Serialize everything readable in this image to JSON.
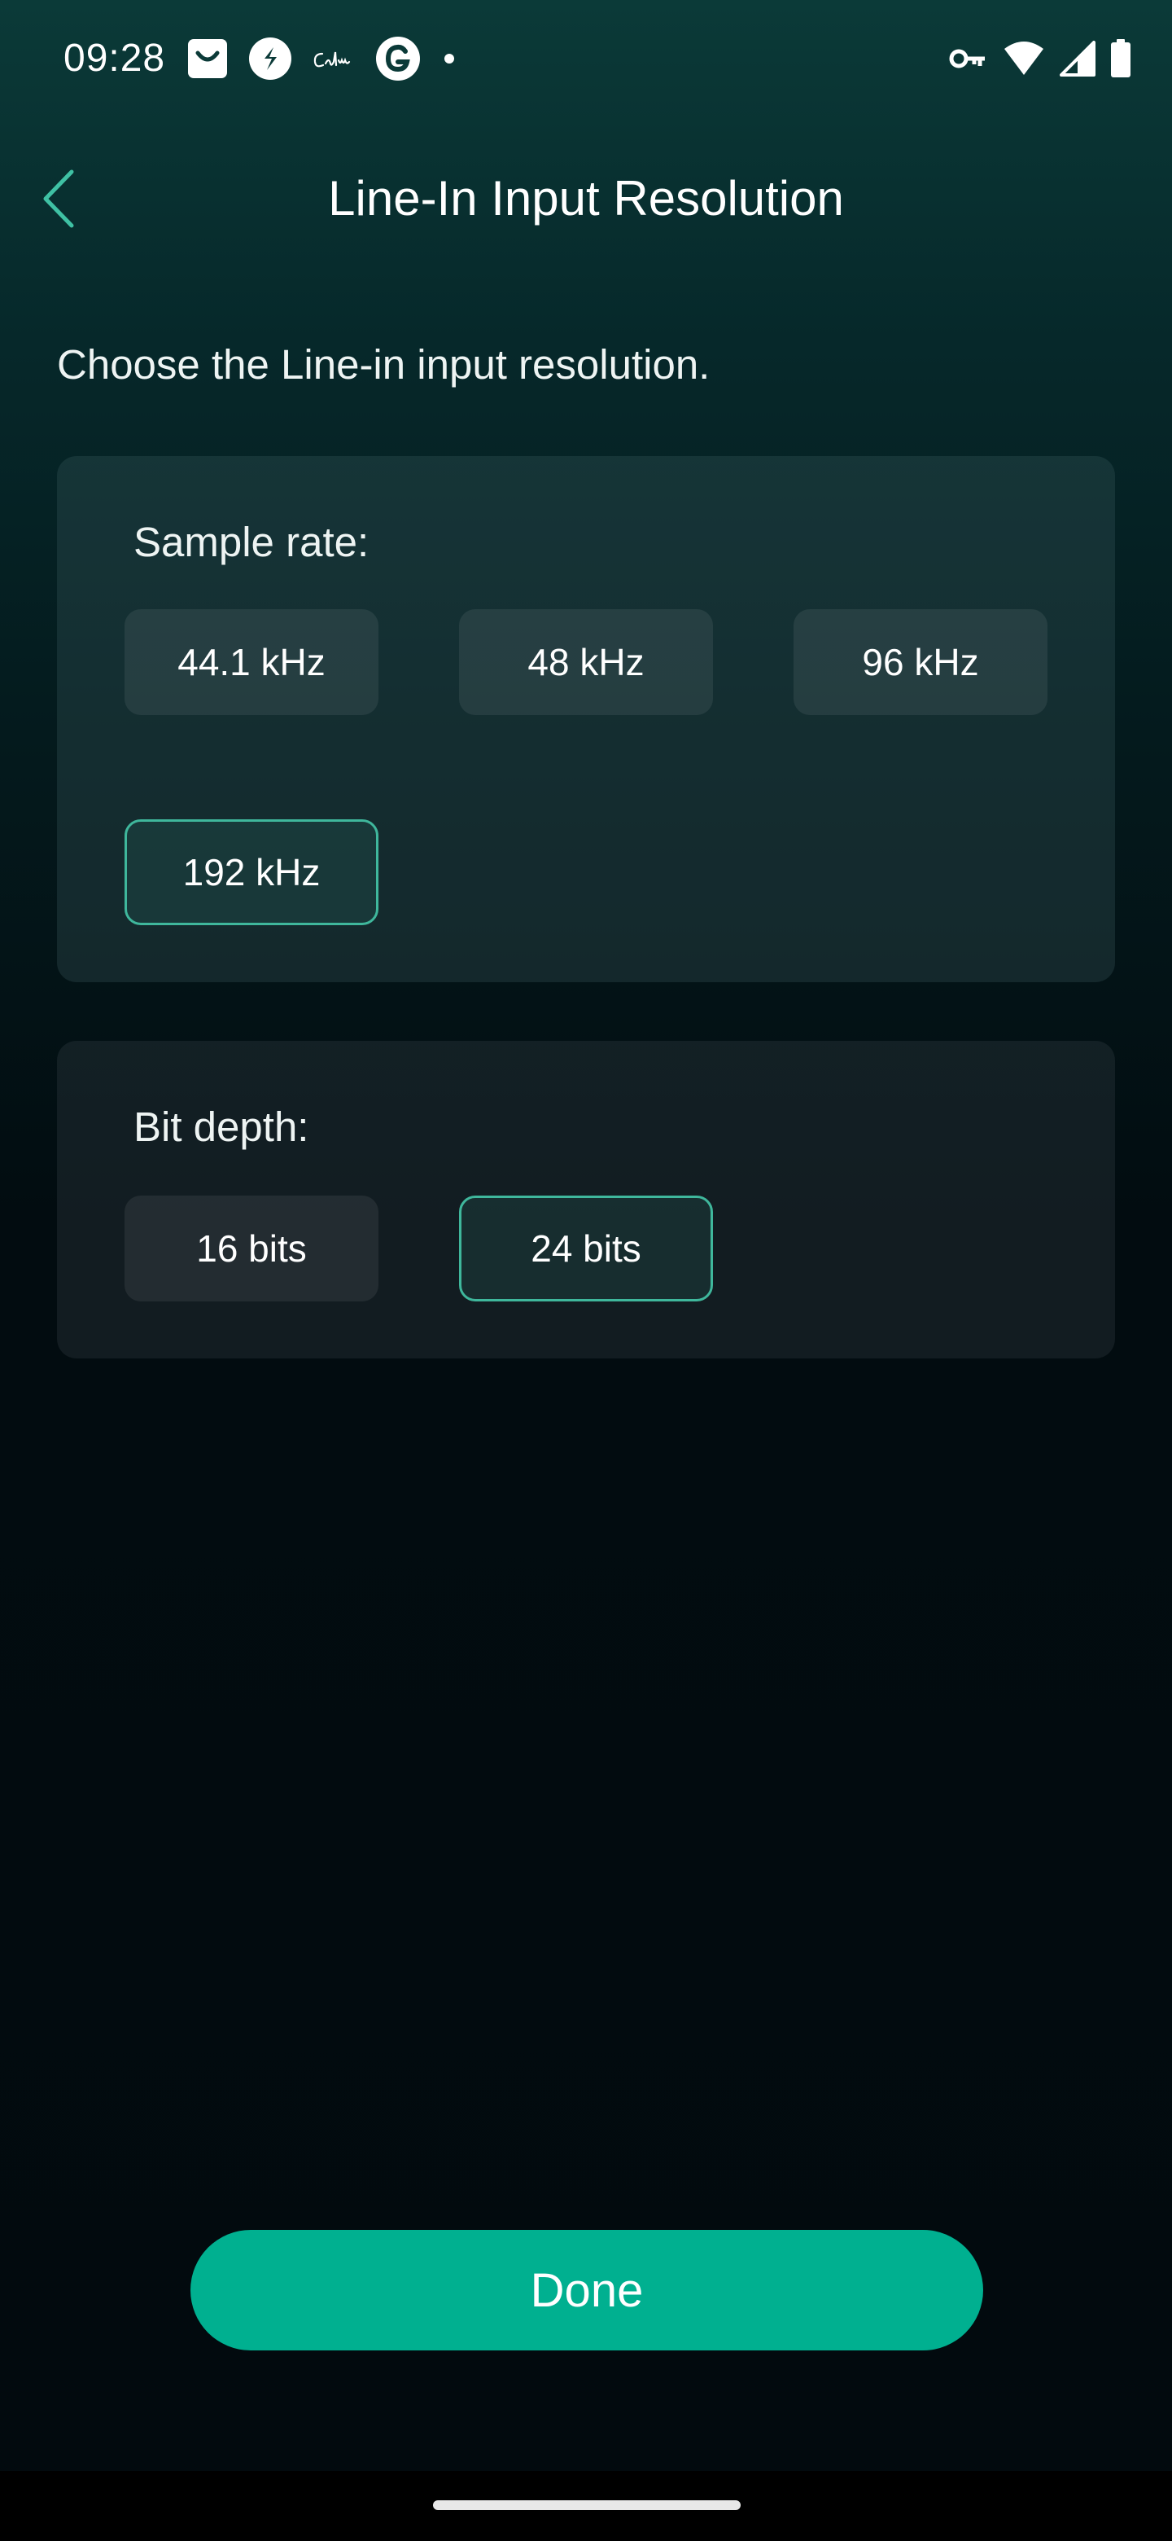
{
  "status_bar": {
    "time": "09:28",
    "left_icons": [
      "shopping-bag-icon",
      "shazam-icon",
      "calm-icon",
      "grammarly-icon",
      "dot-icon"
    ],
    "right_icons": [
      "vpn-key-icon",
      "wifi-icon",
      "cellular-signal-icon",
      "battery-icon"
    ]
  },
  "app_bar": {
    "back_icon": "chevron-left-icon",
    "title": "Line-In Input Resolution"
  },
  "subtitle": "Choose the Line-in input resolution.",
  "sample_rate": {
    "label": "Sample rate:",
    "options": [
      "44.1 kHz",
      "48 kHz",
      "96 kHz",
      "192 kHz"
    ],
    "selected": "192 kHz"
  },
  "bit_depth": {
    "label": "Bit depth:",
    "options": [
      "16 bits",
      "24 bits"
    ],
    "selected": "24 bits"
  },
  "done_label": "Done",
  "colors": {
    "accent": "#00b090",
    "selected_border": "#3fb79c",
    "back_icon": "#3fc1a4"
  }
}
